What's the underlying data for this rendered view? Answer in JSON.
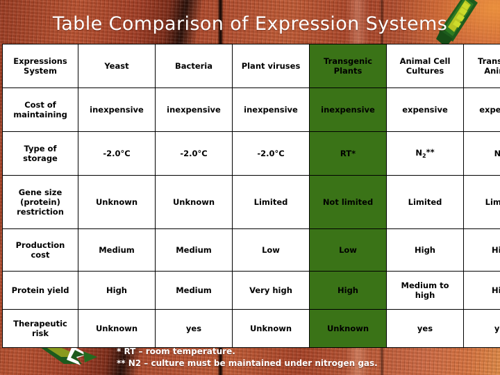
{
  "slide": {
    "title": "Table Comparison of Expression Systems",
    "accent_green": "#3a7317",
    "background_red": "#ab452a",
    "title_color": "#ffffff",
    "highlight_column": "Transgenic Plants"
  },
  "table": {
    "columns": [
      "Expressions System",
      "Yeast",
      "Bacteria",
      "Plant viruses",
      "Transgenic Plants",
      "Animal Cell Cultures",
      "Transgenic Animals"
    ],
    "header_labels": {
      "c0_line1": "Expressions",
      "c0_line2": "System",
      "c1": "Yeast",
      "c2": "Bacteria",
      "c3": "Plant viruses",
      "c4_line1": "Transgenic",
      "c4_line2": "Plants",
      "c5_line1": "Animal Cell",
      "c5_line2": "Cultures",
      "c6_line1": "Transgenic",
      "c6_line2": "Animals"
    },
    "rows": [
      {
        "label_line1": "Cost of",
        "label_line2": "maintaining",
        "label": "Cost of maintaining",
        "cells": [
          "inexpensive",
          "inexpensive",
          "inexpensive",
          "inexpensive",
          "expensive",
          "expensive"
        ]
      },
      {
        "label_line1": "Type of",
        "label_line2": "storage",
        "label": "Type of storage",
        "cells": [
          "-2.0°C",
          "-2.0°C",
          "-2.0°C",
          "RT*",
          "N2**",
          "N/A"
        ]
      },
      {
        "label_line1": "Gene size",
        "label_line2": "(protein)",
        "label_line3": "restriction",
        "label": "Gene size (protein) restriction",
        "cells": [
          "Unknown",
          "Unknown",
          "Limited",
          "Not limited",
          "Limited",
          "Limited"
        ]
      },
      {
        "label_line1": "Production",
        "label_line2": "cost",
        "label": "Production cost",
        "cells": [
          "Medium",
          "Medium",
          "Low",
          "Low",
          "High",
          "High"
        ]
      },
      {
        "label_line1": "Protein yield",
        "label_line2": "",
        "label": "Protein yield",
        "cells": [
          "High",
          "Medium",
          "Very high",
          "High",
          "Medium to high",
          "High"
        ]
      },
      {
        "label_line1": "Therapeutic",
        "label_line2": "risk",
        "label": "Therapeutic risk",
        "cells": [
          "Unknown",
          "yes",
          "Unknown",
          "Unknown",
          "yes",
          "yes"
        ]
      }
    ],
    "special_cells": {
      "n2_base": "N",
      "n2_sub": "2",
      "n2_ast": "**",
      "rt_text": "RT*",
      "yield_animal_line1": "Medium to",
      "yield_animal_line2": "high"
    }
  },
  "footnotes": {
    "line1": "* RT – room temperature.",
    "line2": "** N2 – culture must be maintained under nitrogen gas."
  }
}
